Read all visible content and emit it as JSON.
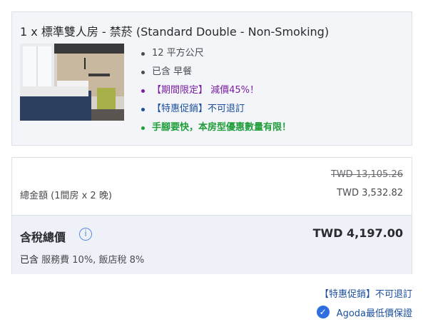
{
  "room": {
    "title": "1 x 標準雙人房 - 禁菸 (Standard Double - Non-Smoking)",
    "features": [
      {
        "text": "12 平方公尺",
        "color": "#4a4a4f"
      },
      {
        "text": "已含 早餐",
        "color": "#4a4a4f"
      },
      {
        "text": "【期間限定】 減價45%！",
        "color": "#7a1fa2"
      },
      {
        "text": "【特惠促銷】不可退訂",
        "color": "#1a4f9c"
      },
      {
        "text": "手腳要快，本房型優惠數量有限！",
        "color": "#1f9e3a"
      }
    ]
  },
  "pricing": {
    "original_price": "TWD 13,105.26",
    "subtotal_label": "總金額 (1間房 x 2 晚)",
    "subtotal_value": "TWD 3,532.82",
    "total_label": "含稅總價",
    "total_value": "TWD 4,197.00",
    "tax_included_prefix": "已含",
    "tax_note": "服務費 10%, 飯店稅 8%"
  },
  "footer": {
    "promo_text": "【特惠促銷】不可退訂",
    "guarantee_text": "Agoda最低價保證"
  },
  "icons": {
    "info": "info-icon",
    "guarantee": "check-circle-icon"
  }
}
